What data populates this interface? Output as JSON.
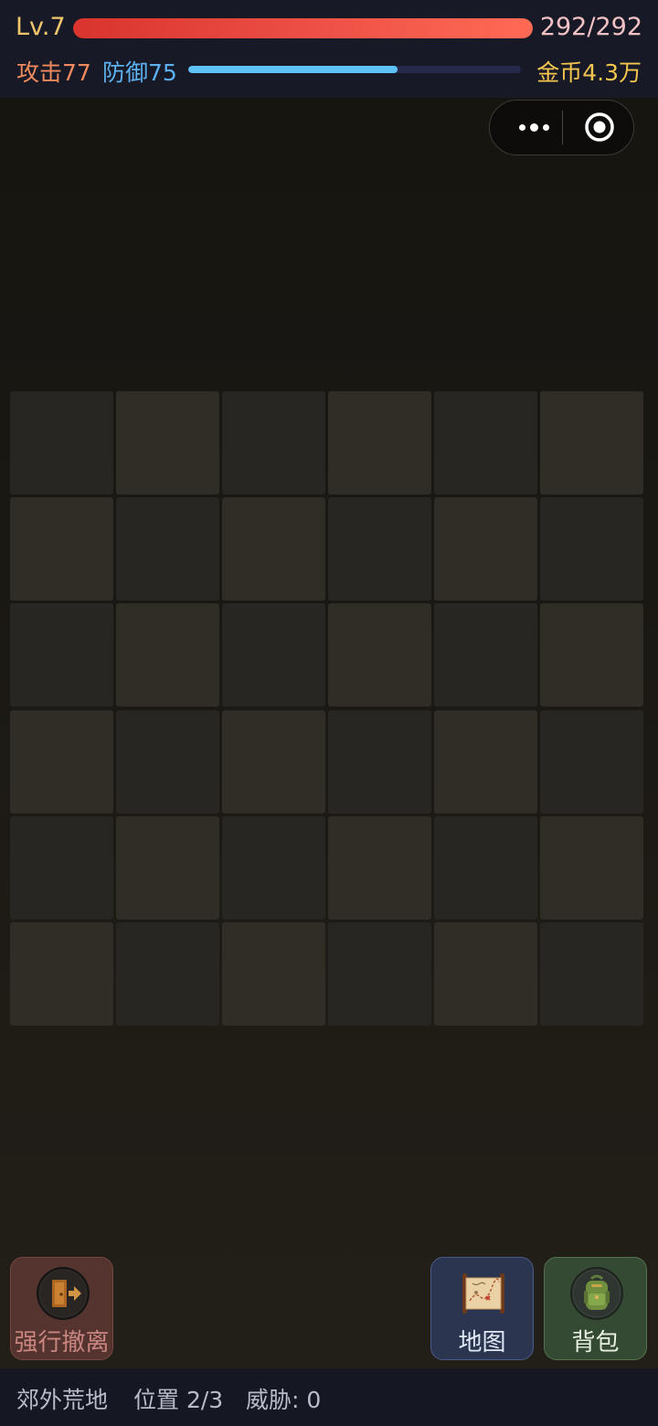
{
  "player": {
    "level_label": "Lv.7",
    "hp_text": "292/292",
    "hp_fraction": 1.0,
    "attack_label": "攻击77",
    "defense_label": "防御75",
    "exp_fraction": 0.63,
    "gold_label": "金币4.3万"
  },
  "capsule": {
    "more_icon": "more-dots-icon",
    "close_icon": "target-circle-icon"
  },
  "board": {
    "rows": 6,
    "cols": 6
  },
  "actions": {
    "evacuate_label": "强行撤离",
    "evacuate_icon": "exit-door-icon",
    "map_label": "地图",
    "map_icon": "treasure-map-icon",
    "bag_label": "背包",
    "bag_icon": "backpack-icon"
  },
  "info": {
    "location": "郊外荒地",
    "position": "位置 2/3",
    "threat": "威胁: 0"
  },
  "colors": {
    "hp": "#ee5146",
    "exp": "#5ec2f6",
    "gold": "#f3c44e",
    "attack": "#f08a5d",
    "defense": "#5db1f2"
  }
}
